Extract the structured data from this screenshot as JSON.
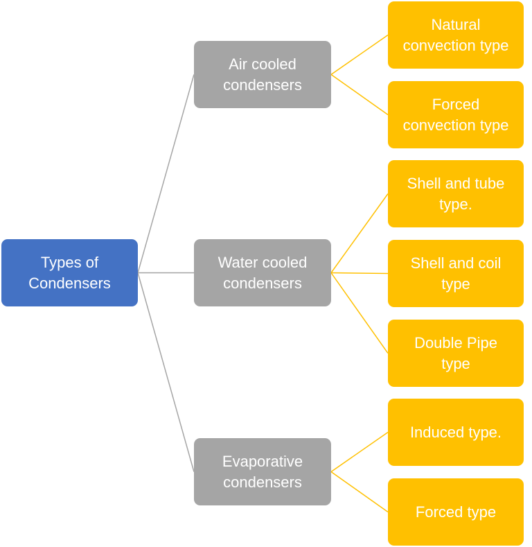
{
  "colors": {
    "root_fill": "#4472C4",
    "category_fill": "#A5A5A5",
    "leaf_fill": "#FFC000",
    "root_connector": "#A5A5A5",
    "leaf_connector": "#FFC000",
    "text": "#FFFFFF"
  },
  "diagram": {
    "root": {
      "label": "Types of\nCondensers"
    },
    "categories": [
      {
        "label": "Air cooled\ncondensers",
        "children": [
          {
            "label": "Natural\nconvection type"
          },
          {
            "label": "Forced\nconvection type"
          }
        ]
      },
      {
        "label": "Water cooled\ncondensers",
        "children": [
          {
            "label": "Shell and tube\ntype."
          },
          {
            "label": "Shell and coil\ntype"
          },
          {
            "label": "Double Pipe\ntype"
          }
        ]
      },
      {
        "label": "Evaporative\ncondensers",
        "children": [
          {
            "label": "Induced type."
          },
          {
            "label": "Forced type"
          }
        ]
      }
    ]
  }
}
